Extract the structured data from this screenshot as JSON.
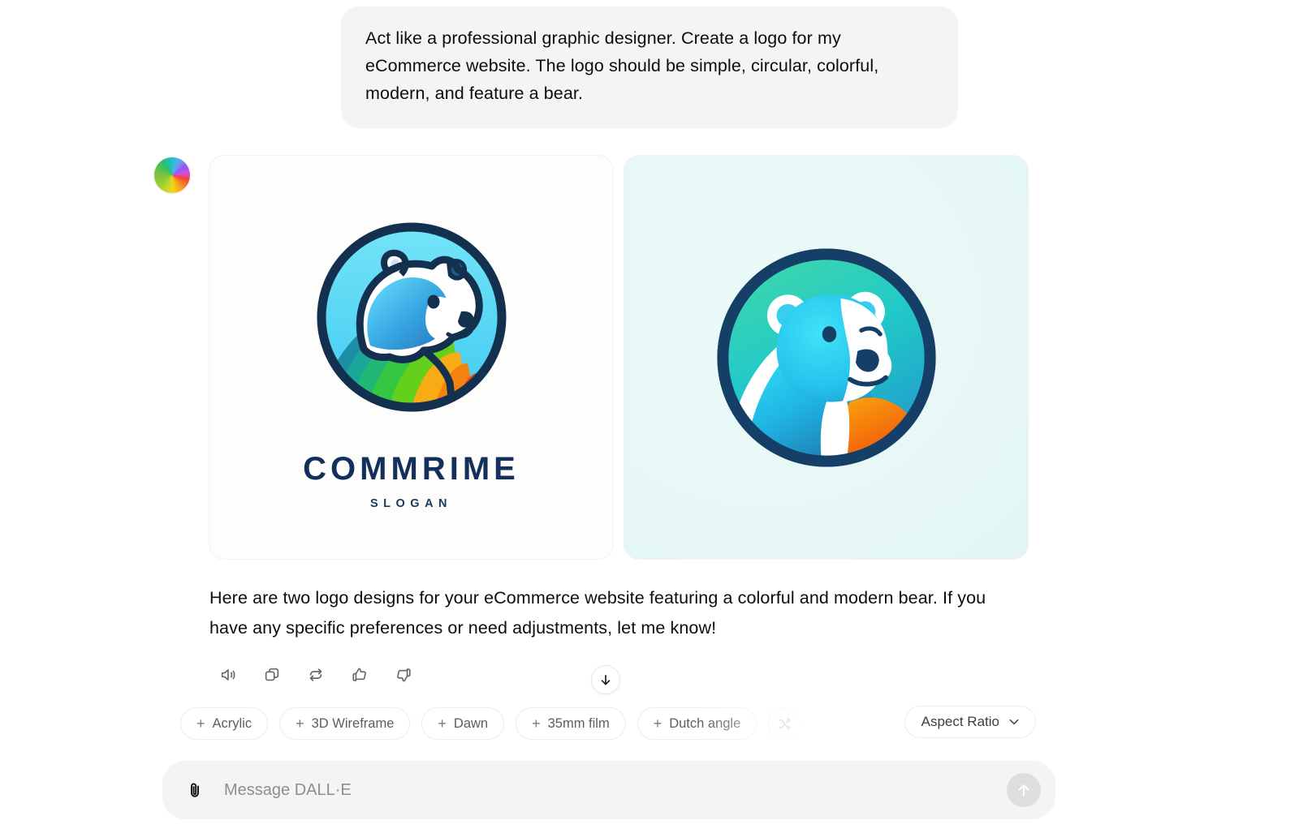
{
  "conversation": {
    "user_message": "Act like a professional graphic designer. Create a logo for my eCommerce website. The logo should be simple, circular, colorful, modern, and feature a bear.",
    "assistant_avatar_icon": "dalle-color-wheel-icon",
    "assistant_message": "Here are two logo designs for your eCommerce website featuring a colorful and modern bear. If you have any specific preferences or need adjustments, let me know!"
  },
  "images": [
    {
      "alt": "Circular bear logo with rainbow stripe mane",
      "brand_text": "COMMRIME",
      "slogan_text": "SLOGAN",
      "card_background": "#fdfdfb",
      "colors": {
        "outline": "#14304f",
        "circle_fill_top": "#6fe2f6",
        "circle_fill_bottom": "#46cdf0",
        "bear_body_light": "#4fc8f2",
        "bear_body_dark": "#2a7fc4",
        "stripe_teal": "#1aa3a0",
        "stripe_green": "#2fc44a",
        "stripe_lime": "#5fd11f",
        "stripe_orange": "#f7a519",
        "stripe_red": "#ef3b1f",
        "muzzle": "#ffffff"
      }
    },
    {
      "alt": "Circular polar bear logo on teal gradient with orange accent",
      "brand_text": "",
      "slogan_text": "",
      "card_background": "#e8f7f6",
      "colors": {
        "outline": "#153f66",
        "circle_top": "#35d1b6",
        "circle_mid": "#25c8c6",
        "circle_bottom": "#1f9fc9",
        "bear_light": "#27d5f0",
        "bear_mid": "#1aa5d6",
        "bear_dark": "#1d7bb0",
        "fur_white": "#ffffff",
        "accent_orange_light": "#f99a10",
        "accent_orange_dark": "#f0560f"
      }
    }
  ],
  "message_actions": [
    {
      "name": "read-aloud",
      "icon": "speaker-icon"
    },
    {
      "name": "copy",
      "icon": "copy-icon"
    },
    {
      "name": "regenerate",
      "icon": "refresh-icon"
    },
    {
      "name": "good-response",
      "icon": "thumbs-up-icon"
    },
    {
      "name": "bad-response",
      "icon": "thumbs-down-icon"
    }
  ],
  "scroll_button": {
    "icon": "arrow-down-icon"
  },
  "style_chips": [
    {
      "label": "Acrylic",
      "prefix": "+"
    },
    {
      "label": "3D Wireframe",
      "prefix": "+"
    },
    {
      "label": "Dawn",
      "prefix": "+"
    },
    {
      "label": "35mm film",
      "prefix": "+"
    },
    {
      "label": "Dutch angle",
      "prefix": "+"
    },
    {
      "label": "",
      "prefix": "",
      "icon": "shuffle-icon"
    }
  ],
  "aspect_ratio": {
    "label": "Aspect Ratio",
    "icon": "chevron-down-icon"
  },
  "composer": {
    "attach_icon": "paperclip-icon",
    "placeholder": "Message DALL·E",
    "value": "",
    "send_icon": "arrow-up-icon",
    "send_disabled": true
  }
}
